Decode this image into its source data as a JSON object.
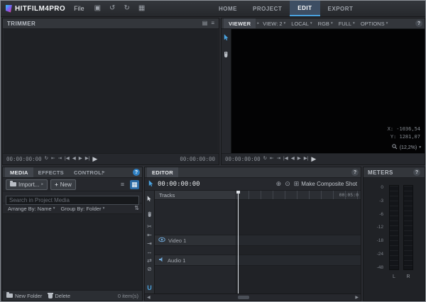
{
  "titlebar": {
    "logo": "HITFILM4PRO",
    "file_menu": "File",
    "tabs": [
      {
        "label": "HOME"
      },
      {
        "label": "PROJECT"
      },
      {
        "label": "EDIT"
      },
      {
        "label": "EXPORT"
      }
    ],
    "active_tab": "EDIT"
  },
  "icons": {
    "save": "▣",
    "undo": "↺",
    "redo": "↻",
    "workspace_grid": "▦",
    "loop": "↻",
    "mark_in": "⇤",
    "mark_out": "⇥",
    "prev_edit": "|◀",
    "prev_frame": "◀",
    "next_frame": "▶",
    "next_edit": "▶|",
    "play": "▶",
    "caret_down": "▾",
    "caret_right": "▸",
    "help": "?",
    "panel_options": "▤",
    "panel_menu": "≡",
    "list_view": "≡",
    "thumb_view": "▦",
    "sort": "⇅",
    "plus": "+",
    "slice_tool": "✂",
    "ripple_tool": "⇤",
    "rolling_tool": "⇥",
    "slip_tool": "↔",
    "slide_tool": "⇄",
    "rate_tool": "⊘",
    "snap": "U",
    "add": "⊕",
    "target": "⊙",
    "composite": "⊞",
    "scroll_left": "◀",
    "scroll_right": "▶"
  },
  "trimmer": {
    "title": "TRIMMER",
    "timecode_left": "00:00:00:00",
    "timecode_right": "00:00:00:00"
  },
  "viewer": {
    "title": "VIEWER",
    "dropdowns": [
      {
        "label": "VIEW: 2"
      },
      {
        "label": "LOCAL"
      },
      {
        "label": "RGB"
      },
      {
        "label": "FULL"
      },
      {
        "label": "OPTIONS"
      }
    ],
    "overlay": {
      "x_coord": "X: -1036,54",
      "y_coord": "Y: 1281,07",
      "zoom": "(12,2%)"
    },
    "timecode": "00:00:00:00"
  },
  "media": {
    "tabs": [
      {
        "label": "MEDIA"
      },
      {
        "label": "EFFECTS"
      },
      {
        "label": "CONTROLS"
      }
    ],
    "active_tab": "MEDIA",
    "import_label": "Import...",
    "new_label": "New",
    "search_placeholder": "Search in Project Media",
    "arrange_by": "Arrange By: Name",
    "group_by": "Group By: Folder",
    "new_folder_label": "New Folder",
    "delete_label": "Delete",
    "item_count": "0 item(s)"
  },
  "editor": {
    "title": "EDITOR",
    "timecode": "00:00:00:00",
    "make_composite_label": "Make Composite Shot",
    "tracks_label": "Tracks",
    "ruler_label": "00:05:0",
    "video_track": "Video 1",
    "audio_track": "Audio 1"
  },
  "meters": {
    "title": "METERS",
    "scale": [
      "0",
      "-3",
      "-6",
      "-12",
      "-18",
      "-24",
      "-48"
    ],
    "left_label": "L",
    "right_label": "R"
  }
}
